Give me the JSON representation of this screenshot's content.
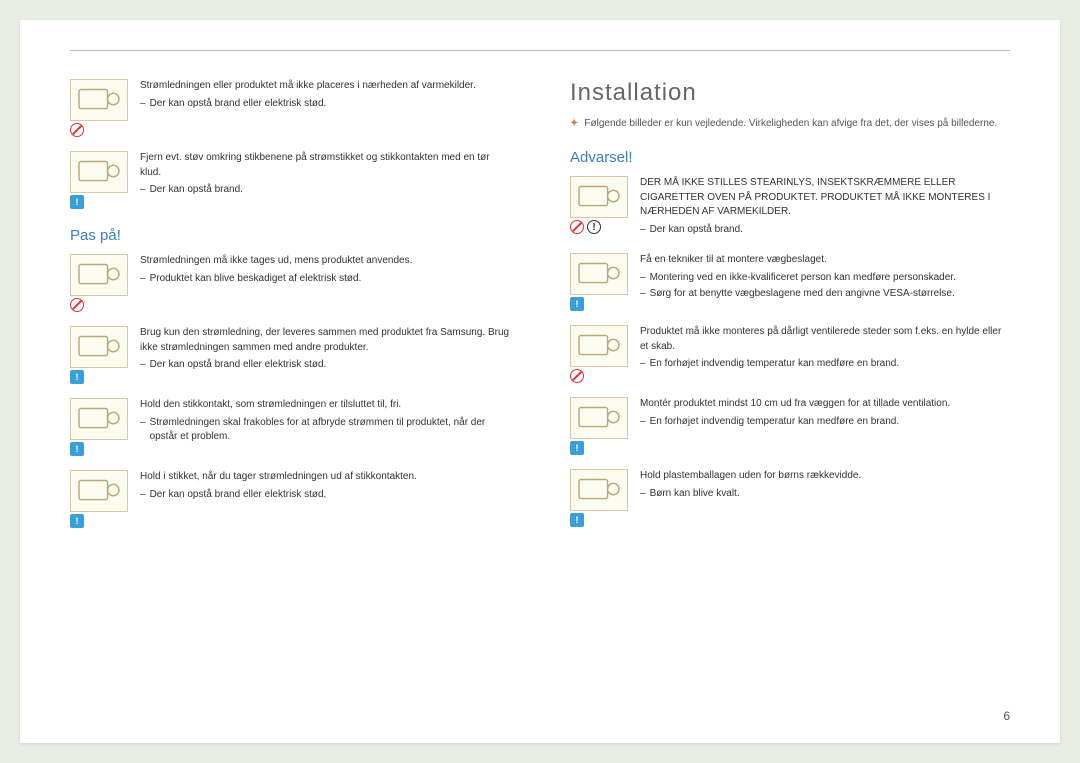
{
  "page_number": "6",
  "left": {
    "items_a": [
      {
        "main": "Strømledningen eller produktet må ikke placeres i nærheden af varmekilder.",
        "subs": [
          "Der kan opstå brand eller elektrisk stød."
        ],
        "badge": "prohibit"
      },
      {
        "main": "Fjern evt. støv omkring stikbenene på strømstikket og stikkontakten med en tør klud.",
        "subs": [
          "Der kan opstå brand."
        ],
        "badge": "info"
      }
    ],
    "heading_b": "Pas på!",
    "items_b": [
      {
        "main": "Strømledningen må ikke tages ud, mens produktet anvendes.",
        "subs": [
          "Produktet kan blive beskadiget af elektrisk stød."
        ],
        "badge": "prohibit"
      },
      {
        "main": "Brug kun den strømledning, der leveres sammen med produktet fra Samsung. Brug ikke strømledningen sammen med andre produkter.",
        "subs": [
          "Der kan opstå brand eller elektrisk stød."
        ],
        "badge": "info"
      },
      {
        "main": "Hold den stikkontakt, som strømledningen er tilsluttet til, fri.",
        "subs": [
          "Strømledningen skal frakobles for at afbryde strømmen til produktet, når der opstår et problem."
        ],
        "badge": "info"
      },
      {
        "main": "Hold i stikket, når du tager strømledningen ud af stikkontakten.",
        "subs": [
          "Der kan opstå brand eller elektrisk stød."
        ],
        "badge": "info"
      }
    ]
  },
  "right": {
    "heading": "Installation",
    "note": "Følgende billeder er kun vejledende. Virkeligheden kan afvige fra det, der vises på billederne.",
    "heading_b": "Advarsel!",
    "items": [
      {
        "main": "DER MÅ IKKE STILLES STEARINLYS, INSEKTSKRÆMMERE ELLER CIGARETTER OVEN PÅ PRODUKTET. PRODUKTET MÅ IKKE MONTERES I NÆRHEDEN AF VARMEKILDER.",
        "subs": [
          "Der kan opstå brand."
        ],
        "badge": "prohibit",
        "excl": true
      },
      {
        "main": "Få en tekniker til at montere vægbeslaget.",
        "subs": [
          "Montering ved en ikke-kvalificeret person kan medføre personskader.",
          "Sørg for at benytte vægbeslagene med den angivne VESA-størrelse."
        ],
        "badge": "info"
      },
      {
        "main": "Produktet må ikke monteres på dårligt ventilerede steder som f.eks. en hylde eller et skab.",
        "subs": [
          "En forhøjet indvendig temperatur kan medføre en brand."
        ],
        "badge": "prohibit"
      },
      {
        "main": "Montér produktet mindst 10 cm ud fra væggen for at tillade ventilation.",
        "subs": [
          "En forhøjet indvendig temperatur kan medføre en brand."
        ],
        "badge": "info"
      },
      {
        "main": "Hold plastemballagen uden for børns rækkevidde.",
        "subs": [
          "Børn kan blive kvalt."
        ],
        "badge": "info"
      }
    ]
  }
}
